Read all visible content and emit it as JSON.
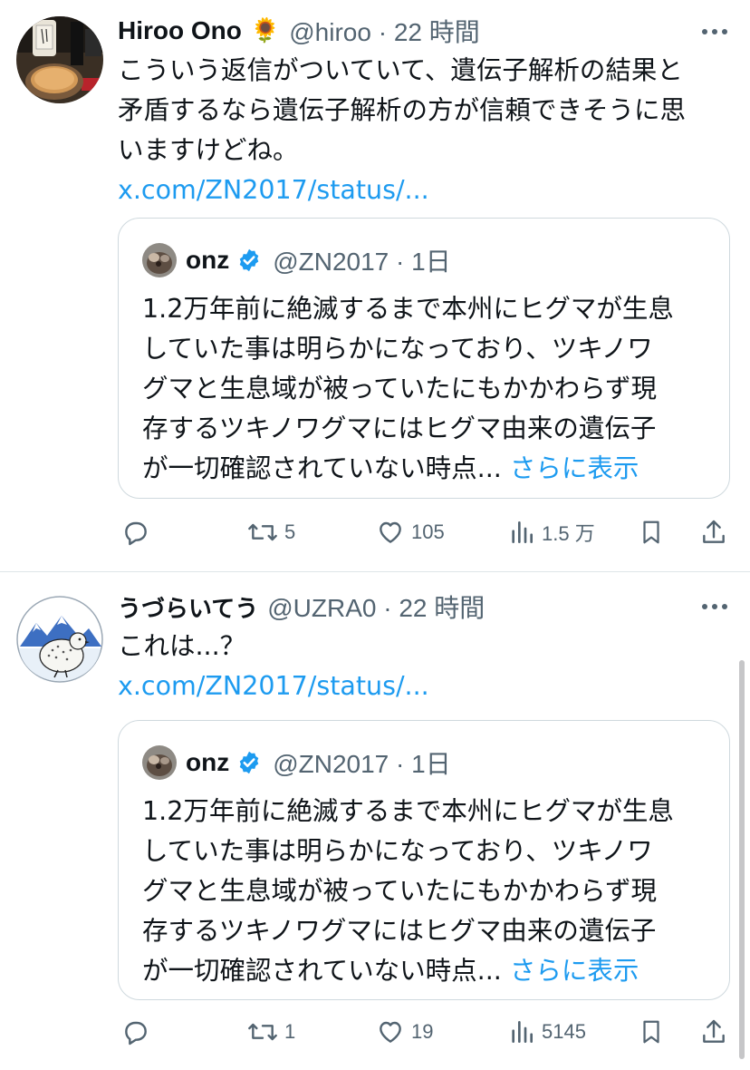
{
  "tweets": [
    {
      "author_name": "Hiroo Ono",
      "author_emoji": "🌻",
      "handle_time": "@hiroo · 22 時間",
      "lines": [
        "こういう返信がついていて、遺伝子解析の結果と",
        "矛盾するなら遺伝子解析の方が信頼できそうに思",
        "いますけどね。"
      ],
      "link": "x.com/ZN2017/status/...",
      "quote": {
        "name": "onz",
        "handle_time": "@ZN2017 · 1日",
        "lines": [
          "1.2万年前に絶滅するまで本州にヒグマが生息",
          "していた事は明らかになっており、ツキノワ",
          "グマと生息域が被っていたにもかかわらず現",
          "存するツキノワグマにはヒグマ由来の遺伝子",
          "が一切確認されていない時点..."
        ],
        "show_more": "さらに表示"
      },
      "stats": {
        "retweets": "5",
        "likes": "105",
        "views": "1.5 万"
      }
    },
    {
      "author_name": "うづらいてう",
      "handle_time": "@UZRA0 · 22 時間",
      "lines": [
        "これは...？"
      ],
      "link": "x.com/ZN2017/status/...",
      "quote": {
        "name": "onz",
        "handle_time": "@ZN2017 · 1日",
        "lines": [
          "1.2万年前に絶滅するまで本州にヒグマが生息",
          "していた事は明らかになっており、ツキノワ",
          "グマと生息域が被っていたにもかかわらず現",
          "存するツキノワグマにはヒグマ由来の遺伝子",
          "が一切確認されていない時点..."
        ],
        "show_more": "さらに表示"
      },
      "stats": {
        "retweets": "1",
        "likes": "19",
        "views": "5145"
      }
    }
  ],
  "icons": {
    "more": "more-horizontal-icon",
    "reply": "reply-bubble-icon",
    "retweet": "retweet-icon",
    "like": "heart-icon",
    "views": "bar-chart-icon",
    "bookmark": "bookmark-icon",
    "share": "share-upload-icon",
    "verified": "verified-badge-icon"
  },
  "colors": {
    "link": "#1d9bf0",
    "secondary": "#536471",
    "verified": "#1d9bf0"
  }
}
